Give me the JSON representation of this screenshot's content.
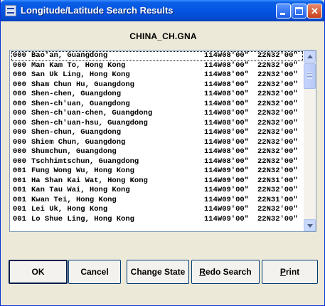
{
  "window": {
    "title": "Longitude/Latitude Search Results",
    "heading": "CHINA_CH.GNA"
  },
  "results": [
    {
      "code": "000",
      "name": "Bao'an, Guangdong",
      "lon": "114W08'00\"",
      "lat": "22N32'00\""
    },
    {
      "code": "000",
      "name": "Man Kam To, Hong Kong",
      "lon": "114W08'00\"",
      "lat": "22N32'00\""
    },
    {
      "code": "000",
      "name": "San Uk Ling, Hong Kong",
      "lon": "114W08'00\"",
      "lat": "22N32'00\""
    },
    {
      "code": "000",
      "name": "Sham Chun Hu, Guangdong",
      "lon": "114W08'00\"",
      "lat": "22N32'00\""
    },
    {
      "code": "000",
      "name": "Shen-chen, Guangdong",
      "lon": "114W08'00\"",
      "lat": "22N32'00\""
    },
    {
      "code": "000",
      "name": "Shen-ch'uan, Guangdong",
      "lon": "114W08'00\"",
      "lat": "22N32'00\""
    },
    {
      "code": "000",
      "name": "Shen-ch'uan-chen, Guangdong",
      "lon": "114W08'00\"",
      "lat": "22N32'00\""
    },
    {
      "code": "000",
      "name": "Shen-ch'uan-hsu, Guangdong",
      "lon": "114W08'00\"",
      "lat": "22N32'00\""
    },
    {
      "code": "000",
      "name": "Shen-chun, Guangdong",
      "lon": "114W08'00\"",
      "lat": "22N32'00\""
    },
    {
      "code": "000",
      "name": "Shiem Chun, Guangdong",
      "lon": "114W08'00\"",
      "lat": "22N32'00\""
    },
    {
      "code": "000",
      "name": "Shumchun, Guangdong",
      "lon": "114W08'00\"",
      "lat": "22N32'00\""
    },
    {
      "code": "000",
      "name": "Tschhimtschun, Guangdong",
      "lon": "114W08'00\"",
      "lat": "22N32'00\""
    },
    {
      "code": "001",
      "name": "Fung Wong Wu, Hong Kong",
      "lon": "114W09'00\"",
      "lat": "22N32'00\""
    },
    {
      "code": "001",
      "name": "Ha Shan Kai Wat, Hong Kong",
      "lon": "114W09'00\"",
      "lat": "22N31'00\""
    },
    {
      "code": "001",
      "name": "Kan Tau Wai, Hong Kong",
      "lon": "114W09'00\"",
      "lat": "22N32'00\""
    },
    {
      "code": "001",
      "name": "Kwan Tei, Hong Kong",
      "lon": "114W09'00\"",
      "lat": "22N31'00\""
    },
    {
      "code": "001",
      "name": "Lei Uk, Hong Kong",
      "lon": "114W09'00\"",
      "lat": "22N32'00\""
    },
    {
      "code": "001",
      "name": "Lo Shue Ling, Hong Kong",
      "lon": "114W09'00\"",
      "lat": "22N32'00\""
    }
  ],
  "buttons": {
    "ok": "OK",
    "cancel": "Cancel",
    "change_state": "Change State",
    "redo_first": "R",
    "redo_rest": "edo Search",
    "print_first": "P",
    "print_rest": "rint"
  }
}
